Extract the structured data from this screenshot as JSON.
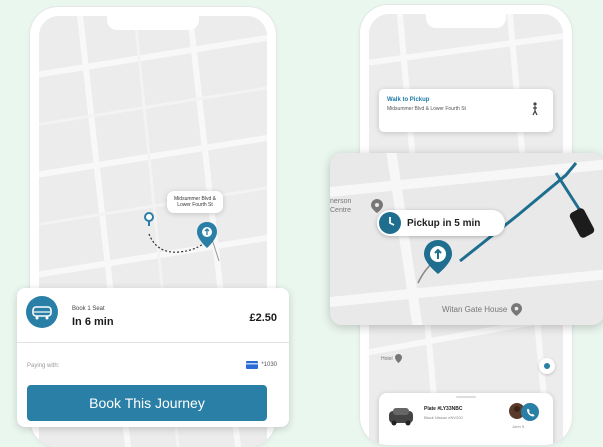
{
  "left_phone": {
    "pickup_callout": "Midsummer Blvd & Lower Fourth St",
    "booking": {
      "seats": "Book 1 Seat",
      "eta": "In 6 min",
      "price": "£2.50",
      "paying_label": "Paying with:",
      "card_last4": "*1030",
      "book_button": "Book This Journey"
    }
  },
  "right_phone": {
    "walk": {
      "title": "Walk to Pickup",
      "location": "Midsummer Blvd & Lower Fourth St"
    },
    "zoom": {
      "place_left": "nerson Centre",
      "pickup_time": "Pickup in 5 min",
      "place_bottom": "Witan Gate House"
    },
    "below_map_label": "Hotel",
    "driver_card": {
      "plate": "Plate #LY33NBC",
      "vehicle": "Black Nissan eNV200",
      "driver": "John S"
    }
  },
  "colors": {
    "accent": "#2a7fa6",
    "route": "#1f6e8f",
    "background": "#eaf7ef",
    "map": "#ececec"
  },
  "icons": [
    "clock-icon",
    "walk-icon",
    "pin-icon",
    "card-icon",
    "phone-icon",
    "arrow-up-icon"
  ]
}
